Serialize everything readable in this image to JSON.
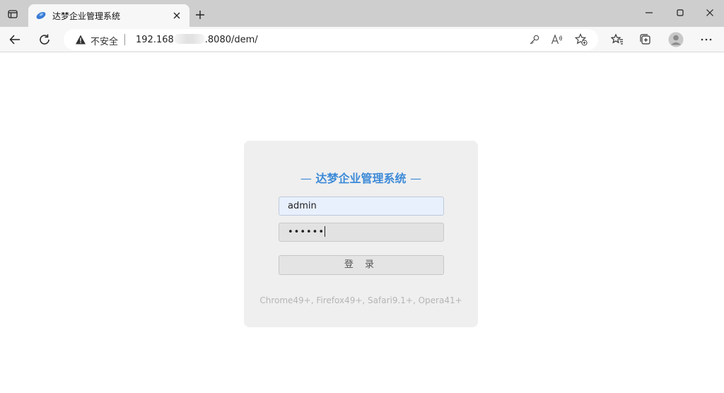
{
  "browser": {
    "tab": {
      "title": "达梦企业管理系统",
      "close": "×"
    },
    "new_tab": "+",
    "address": {
      "security_label": "不安全",
      "url_prefix": "192.168",
      "url_suffix": ".8080/dem/"
    },
    "icons": {
      "tab_actions": "tab-actions-icon",
      "back": "back-arrow-icon",
      "refresh": "refresh-icon",
      "warning": "warning-triangle-icon",
      "password_key": "key-icon",
      "read_aloud": "read-aloud-icon",
      "add_favorite": "add-favorite-icon",
      "favorites": "favorites-icon",
      "collections": "collections-icon",
      "profile": "profile-avatar-icon",
      "more": "more-options-icon"
    }
  },
  "login": {
    "title_left_dash": "—",
    "title": "达梦企业管理系统",
    "title_right_dash": "—",
    "username_value": "admin",
    "password_mask": "••••••",
    "submit_label": "登 录",
    "browser_note": "Chrome49+, Firefox49+, Safari9.1+, Opera41+"
  },
  "colors": {
    "accent": "#3c8ad8",
    "card_bg": "#efefef",
    "autofill_bg": "#e8f0fe",
    "tabstrip_bg": "#cecece"
  }
}
